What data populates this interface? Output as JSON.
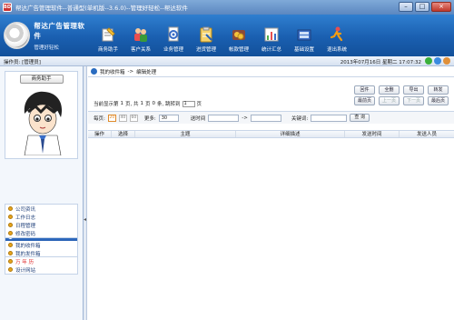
{
  "window": {
    "title": "帮达广告管理软件--普通型(单机版--3.6.0)--管理好轻松--帮达软件",
    "app_icon_text": "BD",
    "minimize": "–",
    "maximize": "□",
    "close": "×"
  },
  "logo": {
    "title": "帮达广告管理软件",
    "subtitle": "管理好轻松"
  },
  "toolbar": {
    "items": [
      {
        "label": "商务助手",
        "icon": "pen-notepad-icon",
        "color": "#f5c23a"
      },
      {
        "label": "客户关系",
        "icon": "people-icon",
        "color": "#e94f4f"
      },
      {
        "label": "业务管理",
        "icon": "gear-document-icon",
        "color": "#f0f0f0"
      },
      {
        "label": "进货管理",
        "icon": "clipboard-icon",
        "color": "#f7d36b"
      },
      {
        "label": "帐款管理",
        "icon": "coins-icon",
        "color": "#d94a3a"
      },
      {
        "label": "统计汇总",
        "icon": "bar-chart-icon",
        "color": "#4fb04f"
      },
      {
        "label": "基础设置",
        "icon": "settings-box-icon",
        "color": "#3a6ec8"
      },
      {
        "label": "退出系统",
        "icon": "exit-runner-icon",
        "color": "#f39c12"
      }
    ]
  },
  "status": {
    "operator": "操作员: [管理员]",
    "date": "2013年07月16日  星期二  17:07:32"
  },
  "assistant": {
    "title": "商务助手"
  },
  "nav": {
    "group1_header": "我的信箱",
    "group1_items": [
      "我的收件箱",
      "我的发件箱"
    ],
    "group2_items": [
      "公司资讯",
      "工作日志",
      "日程管理",
      "修改密码"
    ],
    "group3_items": [
      "万 年 历",
      "设计网站"
    ]
  },
  "breadcrumb": {
    "part1": "我的收件箱",
    "arrow": "->",
    "part2": "编辑处理"
  },
  "pager": {
    "text1": "当前显示第",
    "page": "1",
    "text2": "页, 共",
    "total_pages": "1",
    "text3": "页",
    "count": "0",
    "text4": "条, 跳转到",
    "jump_value": "1",
    "text5": "页",
    "buttons_row1": [
      "回件",
      "全删",
      "导出",
      "转发"
    ],
    "buttons_row2": [
      "最前页",
      "上一页",
      "下一页",
      "最后页"
    ]
  },
  "filter": {
    "size_label": "每页:",
    "sizes": [
      "20",
      "40",
      "60"
    ],
    "more_label": "更多:",
    "more_value": "30",
    "time_label": "送时间",
    "time_arrow": "->",
    "keyword_label": "关键词:",
    "query_button": "查 询"
  },
  "table": {
    "columns": [
      "操作",
      "选择",
      "主题",
      "详细描述",
      "发送时间",
      "发送人员"
    ]
  }
}
